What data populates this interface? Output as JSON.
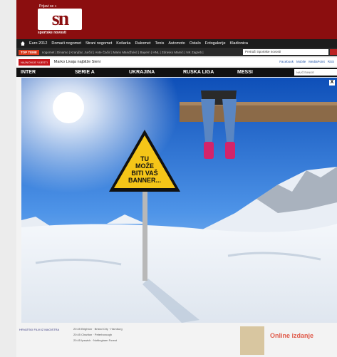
{
  "header": {
    "tagline": "Prijavi se »",
    "logo": "sn",
    "logo_sub": "sportske novosti"
  },
  "menu": {
    "items": [
      "Euro 2012",
      "Domaći nogomet",
      "Strani nogomet",
      "Košarka",
      "Rukomet",
      "Tenis",
      "Automoto",
      "Ostalo",
      "Fotogalerije",
      "Kladionica"
    ]
  },
  "topics": {
    "tag": "TOP TEME",
    "links": "nogomet | Dinamo | Kranjčar, Jurčić | Ante Čačić | Mario Mandžukić | Bayern | HNL | Zdravko Mamić | NK Zagreb |",
    "search_placeholder": "Pretraži Sportske novosti"
  },
  "news": {
    "tag": "NAJNOVIJE VIJESTI",
    "headline": "Marko Livaja najbliže Sieni",
    "social": [
      "Facebook",
      "Mobile",
      "MediaPoint",
      "RSS"
    ]
  },
  "tabs": {
    "items": [
      "INTER",
      "SERIE A",
      "UKRAJINA",
      "RUSKA LIGA",
      "MESSI"
    ],
    "search_label": "NAJČITANIJE"
  },
  "ad": {
    "sign_line1": "TU",
    "sign_line2": "MOŽE",
    "sign_line3": "BITI VAŠ",
    "sign_line4": "BANNER...",
    "close_label": "X"
  },
  "bottom": {
    "left_title": "HRVATSKI FILM IZ MAGISTRA",
    "rows": [
      "20:45 Brighton · Bristol City · Hamburg",
      "20:45 Charlton · Peterborough",
      "20:45 Ipswich · Nottingham Forest"
    ],
    "online": "Online izdanje"
  }
}
